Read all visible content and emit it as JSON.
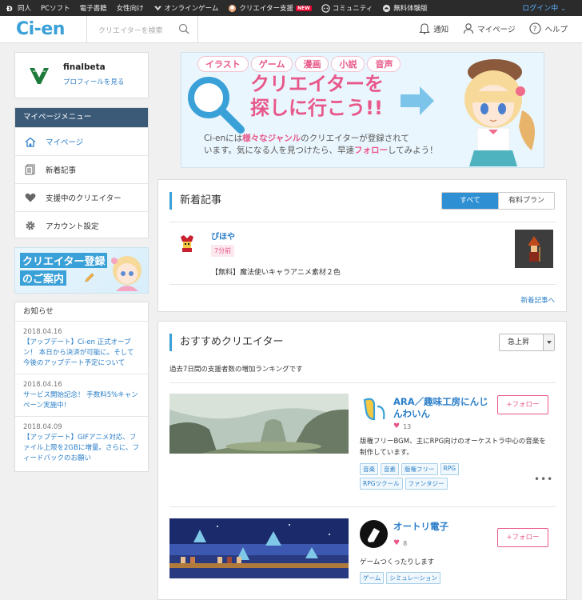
{
  "topbar": {
    "items": [
      {
        "label": "同人",
        "icon": "dlsite-icon"
      },
      {
        "label": "PCソフト",
        "icon": ""
      },
      {
        "label": "電子書籍",
        "icon": ""
      },
      {
        "label": "女性向け",
        "icon": ""
      },
      {
        "label": "オンラインゲーム",
        "icon": "game-icon"
      },
      {
        "label": "クリエイター支援",
        "icon": "ci-en-icon"
      },
      {
        "label": "コミュニティ",
        "icon": "community-icon"
      },
      {
        "label": "無料体験版",
        "icon": "trial-icon"
      }
    ],
    "new_badge": "NEW",
    "login_status": "ログイン中"
  },
  "header": {
    "logo": "Ci-en",
    "search_placeholder": "クリエイターを検索",
    "nav": [
      {
        "label": "通知",
        "icon": "bell-icon"
      },
      {
        "label": "マイページ",
        "icon": "user-icon"
      },
      {
        "label": "ヘルプ",
        "icon": "help-icon"
      }
    ]
  },
  "profile": {
    "username": "finalbeta",
    "link": "プロフィールを見る"
  },
  "menu": {
    "heading": "マイページメニュー",
    "items": [
      {
        "label": "マイページ",
        "icon": "home-icon"
      },
      {
        "label": "新着記事",
        "icon": "document-icon"
      },
      {
        "label": "支援中のクリエイター",
        "icon": "heart-icon"
      },
      {
        "label": "アカウント設定",
        "icon": "gear-icon"
      }
    ]
  },
  "reg_banner": {
    "line1": "クリエイター登録",
    "line2": "のご案内"
  },
  "news": {
    "heading": "お知らせ",
    "items": [
      {
        "date": "2018.04.16",
        "text": "【アップデート】Ci-en 正式オープン！ 本日から決済が可能に。そして今後のアップデート予定について"
      },
      {
        "date": "2018.04.16",
        "text": "サービス開始記念！ 手数料5%キャンペーン実施中！"
      },
      {
        "date": "2018.04.09",
        "text": "【アップデート】GIFアニメ対応、ファイル上限を2GBに増量。さらに、フィードバックのお願い"
      }
    ]
  },
  "banner": {
    "genres": [
      "イラスト",
      "ゲーム",
      "漫画",
      "小説",
      "音声"
    ],
    "headline1": "クリエイターを",
    "headline2": "探しに行こう!!",
    "sub_pre": "Ci-enには",
    "sub_hl": "様々なジャンル",
    "sub_mid": "のクリエイターが登録されて",
    "sub_line2_pre": "います。気になる人を見つけたら、早速",
    "sub_hl2": "フォロー",
    "sub_line2_post": "してみよう！"
  },
  "new_articles": {
    "title": "新着記事",
    "tab_all": "すべて",
    "tab_paid": "有料プラン",
    "article": {
      "author": "ぴほや",
      "time": "7分前",
      "title": "【無料】魔法使いキャラアニメ素材２色"
    },
    "more": "新着記事へ"
  },
  "recommended": {
    "title": "おすすめクリエイター",
    "sort": "急上昇",
    "description": "過去7日間の支援者数の増加ランキングです",
    "follow_label": "+フォロー",
    "creators": [
      {
        "name": "ARA／趣味工房にんじんわいん",
        "likes": "13",
        "description": "版権フリーBGM、主にRPG向けのオーケストラ中心の音楽を制作しています。",
        "tags": [
          "音楽",
          "音素",
          "版権フリー",
          "RPG",
          "RPGツクール",
          "ファンタジー"
        ]
      },
      {
        "name": "オートリ電子",
        "likes": "8",
        "description": "ゲームつくったりします",
        "tags": [
          "ゲーム",
          "シミュレーション"
        ]
      }
    ]
  },
  "colors": {
    "accent": "#3aa0d8",
    "link": "#2a7ec8",
    "pink": "#e8578a",
    "menu_head": "#3b5a78"
  }
}
